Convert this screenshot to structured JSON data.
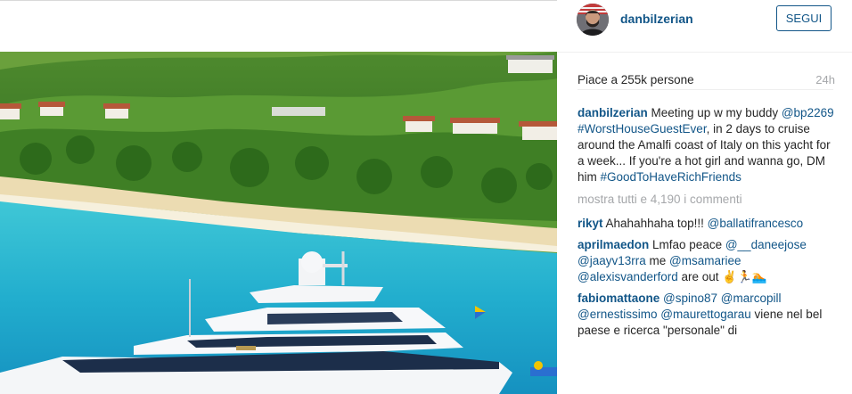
{
  "post": {
    "username": "danbilzerian",
    "follow_label": "SEGUI",
    "likes": "Piace a 255k persone",
    "time": "24h"
  },
  "caption": {
    "user": "danbilzerian",
    "t1": " Meeting up w my buddy ",
    "m1": "@bp2269",
    "t2": " ",
    "m2": "#WorstHouseGuestEver",
    "t3": ", in 2 days to cruise around the Amalfi coast of Italy on this yacht for a week... If you're a hot girl and wanna go, DM him ",
    "m3": "#GoodToHaveRichFriends"
  },
  "show_all": "mostra tutti e 4,190 i commenti",
  "comments": [
    {
      "user": "rikyt",
      "t1": " Ahahahhaha top!!! ",
      "m1": "@ballatifrancesco"
    },
    {
      "user": "aprilmaedon",
      "t1": " Lmfao peace ",
      "m1": "@__daneejose",
      "t2": " ",
      "m2": "@jaayv13rra",
      "t3": " me ",
      "m3": "@msamariee",
      "t4": " ",
      "m4": "@alexisvanderford",
      "t5": " are out ✌️🏃🏊"
    },
    {
      "user": "fabiomattaone",
      "t1": " ",
      "m1": "@spino87",
      "t2": " ",
      "m2": "@marcopill",
      "t3": " ",
      "m3": "@ernestissimo",
      "t4": " ",
      "m4": "@maurettogarau",
      "t5": " viene nel bel paese e ricerca \"personale\" di"
    }
  ],
  "icons": {
    "avatar": "user-avatar-photo"
  },
  "colors": {
    "link": "#125688",
    "muted": "#a5a7aa",
    "text": "#262626"
  }
}
